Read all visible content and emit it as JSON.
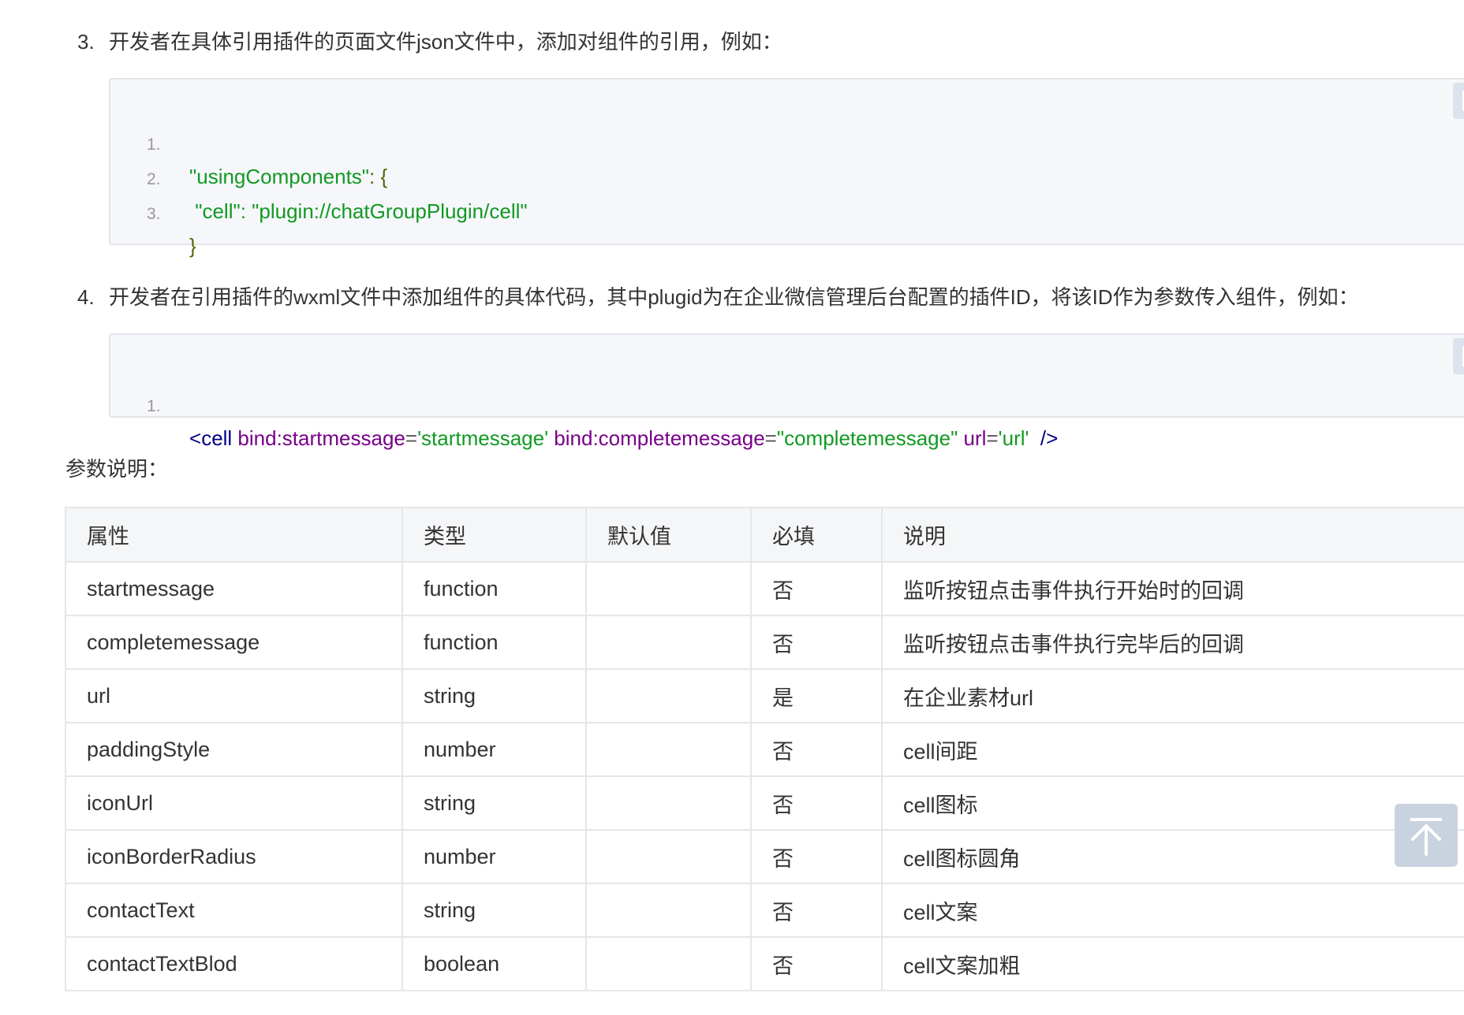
{
  "steps": [
    {
      "number": "3.",
      "text": "开发者在具体引用插件的页面文件json文件中，添加对组件的引用，例如："
    },
    {
      "number": "4.",
      "text": "开发者在引用插件的wxml文件中添加组件的具体代码，其中plugid为在企业微信管理后台配置的插件ID，将该ID作为参数传入组件，例如："
    }
  ],
  "code_block_1": {
    "lines": [
      {
        "no": "1.",
        "parts": [
          "\"usingComponents\"",
          ": {"
        ]
      },
      {
        "no": "2.",
        "parts": [
          " \"cell\"",
          ": ",
          "\"plugin://chatGroupPlugin/cell\""
        ]
      },
      {
        "no": "3.",
        "parts": [
          "}"
        ]
      }
    ]
  },
  "code_block_2": {
    "lines": [
      {
        "no": "1.",
        "parts": [
          "<",
          "cell",
          " bind:startmessage",
          "=",
          "'startmessage'",
          " bind:completemessage",
          "=",
          "\"completemessage\"",
          " url",
          "=",
          "'url'",
          "  />"
        ]
      }
    ]
  },
  "param_heading": "参数说明：",
  "table": {
    "headers": [
      "属性",
      "类型",
      "默认值",
      "必填",
      "说明"
    ],
    "rows": [
      [
        "startmessage",
        "function",
        "",
        "否",
        "监听按钮点击事件执行开始时的回调"
      ],
      [
        "completemessage",
        "function",
        "",
        "否",
        "监听按钮点击事件执行完毕后的回调"
      ],
      [
        "url",
        "string",
        "",
        "是",
        "在企业素材url"
      ],
      [
        "paddingStyle",
        "number",
        "",
        "否",
        "cell间距"
      ],
      [
        "iconUrl",
        "string",
        "",
        "否",
        "cell图标"
      ],
      [
        "iconBorderRadius",
        "number",
        "",
        "否",
        "cell图标圆角"
      ],
      [
        "contactText",
        "string",
        "",
        "否",
        "cell文案"
      ],
      [
        "contactTextBlod",
        "boolean",
        "",
        "否",
        "cell文案加粗"
      ]
    ]
  },
  "icons": {
    "copy": "copy-icon",
    "back_to_top": "arrow-up-to-top-icon"
  },
  "colors": {
    "code_string": "#119922",
    "code_tag": "#000088",
    "code_attr": "#770088",
    "code_plain": "#556600",
    "code_bg": "#f6f7fb",
    "table_header_bg": "#f5f6f8",
    "back_top_bg": "#c9d3df"
  }
}
